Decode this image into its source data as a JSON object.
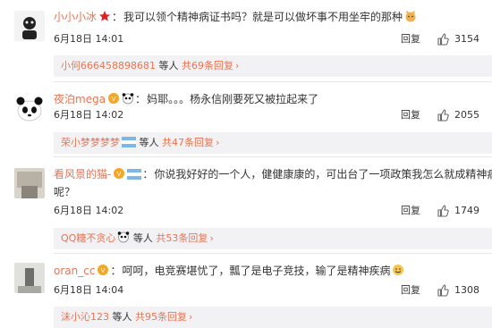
{
  "comments": [
    {
      "username": "小小小冰",
      "text": "我可以领个精神病证书吗？就是可以做坏事不用坐牢的那种",
      "text2": "",
      "time": "6月18日 14:01",
      "reply_label": "回复",
      "likes": "3154",
      "sub": {
        "user": "小何666458898681",
        "mid": "等人",
        "count": "共69条回复"
      }
    },
    {
      "username": "夜泊mega",
      "text": "妈耶。。。杨永信刚要死又被拉起来了",
      "text2": "",
      "time": "6月18日 14:02",
      "reply_label": "回复",
      "likes": "2055",
      "sub": {
        "user": "荣小梦梦梦梦",
        "mid": "等人",
        "count": "共47条回复"
      }
    },
    {
      "username": "看风景的猫-",
      "text": "你说我好好的一个人，健健康康的，可出台了一项政策我怎么就成精神病了",
      "text2": "呢？",
      "time": "6月18日 14:02",
      "reply_label": "回复",
      "likes": "1749",
      "sub": {
        "user": "QQ糖不贪心",
        "mid": "等人",
        "count": "共53条回复"
      }
    },
    {
      "username": "oran_cc",
      "text": "呵呵，电竞赛堪忧了，瓢了是电子竞技，输了是精神疾病",
      "text2": "",
      "time": "6月18日 14:04",
      "reply_label": "回复",
      "likes": "1308",
      "sub": {
        "user": "沫小沁123",
        "mid": "等人",
        "count": "共95条回复"
      }
    }
  ],
  "colors": {
    "username": "#eb7350",
    "reply_bg": "#f2f2f5"
  },
  "icons": [
    "star-icon",
    "cat-emoji-icon",
    "panda-emoji-icon",
    "vip-badge-icon",
    "flag-icon",
    "like-icon",
    "arrow-icon",
    "smile-emoji-icon"
  ]
}
